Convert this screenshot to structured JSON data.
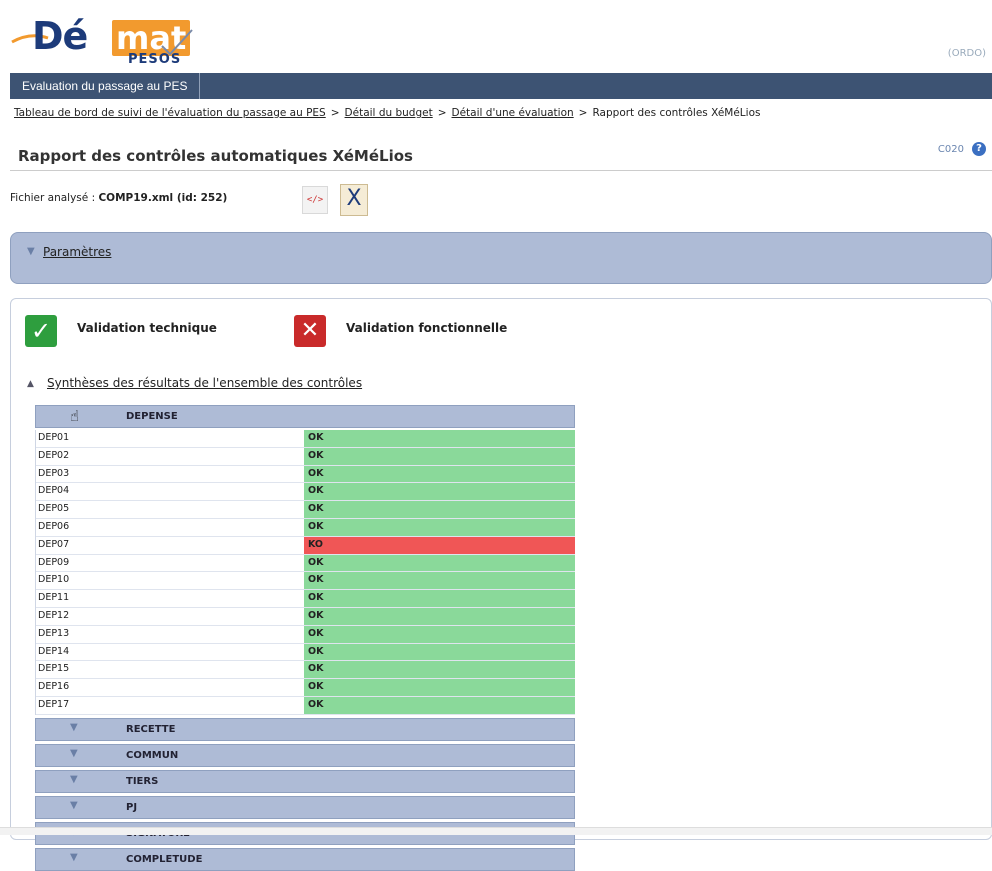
{
  "logo": {
    "text_de": "Dé",
    "text_mat": "mat",
    "text_pesos": "PESOS"
  },
  "header": {
    "ordo": "(ORDO)"
  },
  "nav": {
    "tab": "Evaluation du passage au PES"
  },
  "breadcrumb": {
    "items": [
      "Tableau de bord de suivi de l'évaluation du passage au PES",
      "Détail du budget",
      "Détail d'une évaluation"
    ],
    "current": "Rapport des contrôles XéMéLios",
    "separator": ">"
  },
  "page": {
    "title": "Rapport des contrôles automatiques XéMéLios",
    "code": "C020",
    "help": "?"
  },
  "file": {
    "label": "Fichier analysé :",
    "name": "COMP19.xml (id: 252)",
    "xml_icon": "</>",
    "x_icon": "X"
  },
  "params": {
    "label": "Paramètres"
  },
  "validation": {
    "technique": {
      "label": "Validation technique",
      "icon": "check-icon",
      "status": "ok"
    },
    "fonctionnelle": {
      "label": "Validation fonctionnelle",
      "icon": "cross-icon",
      "status": "ko"
    }
  },
  "synthesis": {
    "label": "Synthèses des résultats de l'ensemble des contrôles"
  },
  "depense": {
    "label": "DEPENSE",
    "rows": [
      {
        "id": "DEP01",
        "status": "OK"
      },
      {
        "id": "DEP02",
        "status": "OK"
      },
      {
        "id": "DEP03",
        "status": "OK"
      },
      {
        "id": "DEP04",
        "status": "OK"
      },
      {
        "id": "DEP05",
        "status": "OK"
      },
      {
        "id": "DEP06",
        "status": "OK"
      },
      {
        "id": "DEP07",
        "status": "KO"
      },
      {
        "id": "DEP09",
        "status": "OK"
      },
      {
        "id": "DEP10",
        "status": "OK"
      },
      {
        "id": "DEP11",
        "status": "OK"
      },
      {
        "id": "DEP12",
        "status": "OK"
      },
      {
        "id": "DEP13",
        "status": "OK"
      },
      {
        "id": "DEP14",
        "status": "OK"
      },
      {
        "id": "DEP15",
        "status": "OK"
      },
      {
        "id": "DEP16",
        "status": "OK"
      },
      {
        "id": "DEP17",
        "status": "OK"
      }
    ]
  },
  "sections": [
    "RECETTE",
    "COMMUN",
    "TIERS",
    "PJ",
    "SIGNATURE",
    "COMPLETUDE"
  ],
  "colors": {
    "ok": "#8ad99a",
    "ko": "#f05656",
    "nav": "#3d5373",
    "panel": "#aebbd6"
  }
}
